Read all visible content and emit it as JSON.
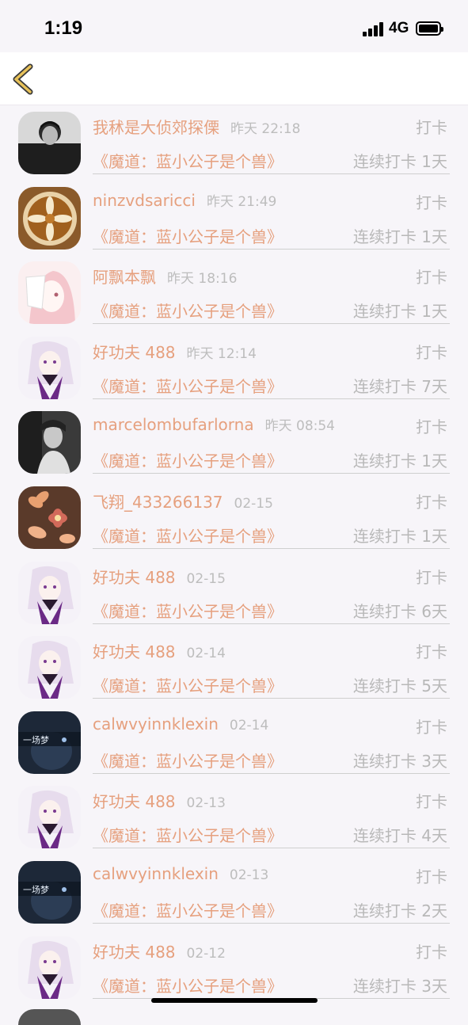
{
  "status_bar": {
    "time": "1:19",
    "network": "4G"
  },
  "nav": {
    "back_icon": "chevron-left-icon"
  },
  "colors": {
    "accent": "#e6a07e",
    "muted": "#b8b8b8",
    "background": "#f7f5f9"
  },
  "rows": [
    {
      "name": "我秫是大侦郊探傈",
      "time": "昨天 22:18",
      "action": "打卡",
      "book": "《魔道：蓝小公子是个兽》",
      "streak": "连续打卡 1天",
      "avatar": "avatar-man-dark"
    },
    {
      "name": "ninzvdsaricci",
      "time": "昨天 21:49",
      "action": "打卡",
      "book": "《魔道：蓝小公子是个兽》",
      "streak": "连续打卡 1天",
      "avatar": "avatar-latte"
    },
    {
      "name": "阿飘本飘",
      "time": "昨天 18:16",
      "action": "打卡",
      "book": "《魔道：蓝小公子是个兽》",
      "streak": "连续打卡 1天",
      "avatar": "avatar-anime-mask"
    },
    {
      "name": "好功夫 488",
      "time": "昨天 12:14",
      "action": "打卡",
      "book": "《魔道：蓝小公子是个兽》",
      "streak": "连续打卡 7天",
      "avatar": "avatar-anime-purple"
    },
    {
      "name": "marcelombufarlorna",
      "time": "昨天 08:54",
      "action": "打卡",
      "book": "《魔道：蓝小公子是个兽》",
      "streak": "连续打卡 1天",
      "avatar": "avatar-bw-person"
    },
    {
      "name": "飞翔_433266137",
      "time": "02-15",
      "action": "打卡",
      "book": "《魔道：蓝小公子是个兽》",
      "streak": "连续打卡 1天",
      "avatar": "avatar-flowers"
    },
    {
      "name": "好功夫 488",
      "time": "02-15",
      "action": "打卡",
      "book": "《魔道：蓝小公子是个兽》",
      "streak": "连续打卡 6天",
      "avatar": "avatar-anime-purple"
    },
    {
      "name": "好功夫 488",
      "time": "02-14",
      "action": "打卡",
      "book": "《魔道：蓝小公子是个兽》",
      "streak": "连续打卡 5天",
      "avatar": "avatar-anime-purple"
    },
    {
      "name": "calwvyinnklexin",
      "time": "02-14",
      "action": "打卡",
      "book": "《魔道：蓝小公子是个兽》",
      "streak": "连续打卡 3天",
      "avatar": "avatar-dream",
      "avatar_text": "一场梦"
    },
    {
      "name": "好功夫 488",
      "time": "02-13",
      "action": "打卡",
      "book": "《魔道：蓝小公子是个兽》",
      "streak": "连续打卡 4天",
      "avatar": "avatar-anime-purple"
    },
    {
      "name": "calwvyinnklexin",
      "time": "02-13",
      "action": "打卡",
      "book": "《魔道：蓝小公子是个兽》",
      "streak": "连续打卡 2天",
      "avatar": "avatar-dream",
      "avatar_text": "一场梦"
    },
    {
      "name": "好功夫 488",
      "time": "02-12",
      "action": "打卡",
      "book": "《魔道：蓝小公子是个兽》",
      "streak": "连续打卡 3天",
      "avatar": "avatar-anime-purple"
    }
  ]
}
